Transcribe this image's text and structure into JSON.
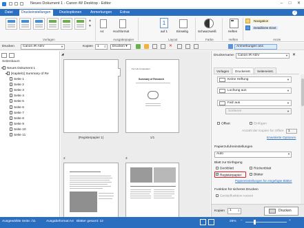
{
  "window": {
    "title": "Neues Dokument 1 - Canon iW Desktop - Editor",
    "controls": [
      "–",
      "□",
      "✕"
    ]
  },
  "tabs": [
    "Datei",
    "Druckeinstellungen",
    "Druckoptionen",
    "Anmerkungen",
    "Extras"
  ],
  "ribbon": {
    "groups": [
      "Vorlagen",
      "Ausgabepapier",
      "Layout",
      "Farbe",
      "Heften",
      "Anzei"
    ],
    "paper_size": "A4",
    "orientation": "Hochformat",
    "pages_per_sheet_top": "1",
    "pages_per_sheet_bottom": "auf 1",
    "duplex": "Einseitig",
    "color_mode": "Schwarzweiß",
    "staple": "Heften",
    "navigation": "Navigation",
    "detailed": "Detaillierte Einst"
  },
  "toolbar": {
    "printer_label": "Drucken",
    "printer_value": "Canon iR-ADV",
    "copies_label": "Kopien",
    "copies_value": "1",
    "print_button": "Drucken",
    "annotations_button": "Anmerkungen anz."
  },
  "left_pane": {
    "header": "Seitenbaum",
    "root": "Neues Dokument 1",
    "chapter": "[Kapitel1] Summary of Re",
    "pages": [
      "Seite 1",
      "Seite 2",
      "Seite 3",
      "Seite 4",
      "Seite 5",
      "Seite 6",
      "Seite 7",
      "Seite 8",
      "Seite 9",
      "Seite 10",
      "Seite 11"
    ]
  },
  "center": {
    "tab_caption": "(Registerpapier 1)",
    "page1_caption": "1/1",
    "num_left": "2",
    "num_right": "3",
    "doc_title_line": "Summary of Research",
    "doc_sub": "For Life Corporation"
  },
  "right_panel": {
    "printer_name_label": "Druckername:",
    "printer_name_value": "Canon iR-ADV",
    "tabs": [
      "Vorlagen",
      "Druckeinst.",
      "Seiteneinst."
    ],
    "staple_option": "Keine Heftung",
    "punch_option": "Lochung aus",
    "fold_option": "Falz aus",
    "fold_sub": "Sortieren",
    "offset": "Offset",
    "insert": "Einfügen",
    "offset_count_label": "Anzahl der Kopien für Offset",
    "offset_count_value": "1",
    "advanced_options": "Erweiterte Optionen",
    "paper_source_label": "Papierzufuhreinstellungen",
    "paper_source_value": "Auto",
    "insert_sheet_label": "Blatt zur Einfügung",
    "cover": "Deckblatt",
    "back_cover": "Rückenblatt",
    "tab_paper": "Registerpapier",
    "sheets": "Blätter",
    "tab_settings_link": "Papiereinstellungen für eingefügte Blätter",
    "secure_label": "Funktion für sicheres Drucken",
    "secure_option": "Geräteflunktion nutzen",
    "copies_label": "Kopien",
    "copies_value": "1",
    "print_button": "Drucken"
  },
  "status": {
    "selected_page": "Ausgewählte Seite: /11",
    "output_format": "Ausgabeformat:A4",
    "total_sheets": "Blätter gesamt: 12",
    "zoom": "25%"
  },
  "colors": {
    "accent": "#2a6ec0",
    "highlight": "#e02020",
    "nav_button": "#f7d36a"
  }
}
